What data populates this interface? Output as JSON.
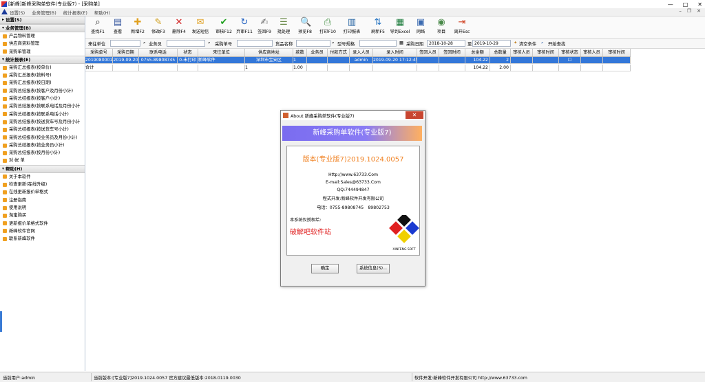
{
  "window": {
    "title": "[新峰]新峰采购单软件(专业版7) - [采购单]",
    "controls": [
      "—",
      "□",
      "✕"
    ]
  },
  "menubar": {
    "items": [
      "设置(S)",
      "业务管理(B)",
      "统计报表(E)",
      "帮助(H)"
    ],
    "mdi_controls": [
      "–",
      "❐",
      "✕"
    ]
  },
  "sidebar": {
    "sections": [
      {
        "title": "设置(S)",
        "items": []
      },
      {
        "title": "业务管理(B)",
        "items": [
          "产品物料管理",
          "供应商资料管理",
          "采购单管理"
        ]
      },
      {
        "title": "统计报表(E)",
        "items": [
          "采购汇总报表(按单价)",
          "采购汇总报表(按料号)",
          "采购汇总报表(按日期)",
          "采购总结报表(按客户及月份小计)",
          "采购总结报表(按客户小计)",
          "采购总结报表(按联系电话及月份小计",
          "采购总结报表(按联系电话小计)",
          "采购总结报表(按送货车号及月份小计",
          "采购总结报表(按送货车号小计)",
          "采购总结报表(按业务员及月份小计)",
          "采购总结报表(按业务员小计)",
          "采购总结报表(按月份小计)",
          "对 帐 单"
        ]
      },
      {
        "title": "帮助(H)",
        "items": [
          "关于本软件",
          "检查更新(在线升级)",
          "在线更新报价单格式",
          "注册指南",
          "使用说明",
          "淘宝购买",
          "更新报价单格式软件",
          "新峰软件官网",
          "联系新峰软件"
        ]
      }
    ]
  },
  "toolbar": {
    "buttons": [
      {
        "label": "查找F1",
        "icon": "binoculars-icon"
      },
      {
        "label": "查看",
        "icon": "view-icon"
      },
      {
        "label": "新增F2",
        "icon": "new-doc-icon"
      },
      {
        "label": "修改F3",
        "icon": "edit-icon"
      },
      {
        "label": "删除F4",
        "icon": "delete-icon"
      },
      {
        "label": "发送短信",
        "icon": "sms-icon"
      },
      {
        "label": "审核F12",
        "icon": "check-icon"
      },
      {
        "label": "弃审F11",
        "icon": "refresh-icon"
      },
      {
        "label": "签回F9",
        "icon": "sign-icon"
      },
      {
        "label": "批处理",
        "icon": "batch-icon"
      },
      {
        "label": "预览F8",
        "icon": "preview-icon"
      },
      {
        "label": "打印F10",
        "icon": "print-icon"
      },
      {
        "label": "打印报表",
        "icon": "report-icon"
      },
      {
        "label": "刷新F5",
        "icon": "refresh2-icon"
      },
      {
        "label": "导到Excel",
        "icon": "excel-icon"
      },
      {
        "label": "网络",
        "icon": "network-icon"
      },
      {
        "label": "项目",
        "icon": "project-icon"
      },
      {
        "label": "离开Esc",
        "icon": "exit-icon"
      }
    ]
  },
  "filter": {
    "supplier_label": "来往单位",
    "salesperson_label": "业务员",
    "order_no_label": "采购单号",
    "goods_label": "货品名称",
    "model_label": "型号规格",
    "date_label": "采购日期",
    "date_from": "2018-10-28",
    "to_label": "至",
    "date_to": "2019-10-29",
    "clear_label": "清空条件",
    "search_label": "开始查找"
  },
  "grid": {
    "columns": [
      "采购单号",
      "采购日期",
      "联系电话",
      "状态",
      "来往单位",
      "供应商地址",
      "款数",
      "业务员",
      "付款方式",
      "录入人员",
      "录入时间",
      "签回人员",
      "签回时间",
      "总金额",
      "总数量",
      "审核人员",
      "审核时间",
      "审核状态",
      "审核人员",
      "审核时间"
    ],
    "rows": [
      [
        "2019080001",
        "2019-09-20",
        "0755-89808745",
        "0-未打印",
        "新峰软件",
        "深圳市宝安区",
        "1",
        "",
        "",
        "admin",
        "2019-09-20 17:12:45",
        "",
        "",
        "104.22",
        "2",
        "",
        "",
        "☐",
        "",
        ""
      ],
      [
        "合计",
        "",
        "",
        "",
        "",
        "1",
        "1.00",
        "",
        "",
        "",
        "",
        "",
        "",
        "104.22",
        "2.00",
        "",
        "",
        "",
        "",
        ""
      ]
    ]
  },
  "status": {
    "user": "当前用户:admin",
    "version": "当前版本:[专业版7]2019.1024.0057 官方建议最低版本:2018.0119.0030",
    "developer": "软件开发:新峰软件开发有限公司 http://www.63733.com"
  },
  "about_dialog": {
    "title": "About 新峰采购单软件(专业版7)",
    "close_glyph": "✕",
    "banner": "新峰采购单软件(专业版7)",
    "version": "版本(专业版7)2019.1024.0057",
    "http": "Http://www.63733.Com",
    "email": "E-mail:Sales@63733.Com",
    "qq": "QQ:744494847",
    "developer": "程式开发:新峰软件开发有限公司",
    "phone": "电话：0755-89808745　89802753",
    "licensed_to_label": "本系统仅授权给:",
    "licensee": "破解吧软件站",
    "logo_text": "XINFENG SOFT",
    "ok_label": "确定",
    "sysinfo_label": "系统信息(S)..."
  }
}
